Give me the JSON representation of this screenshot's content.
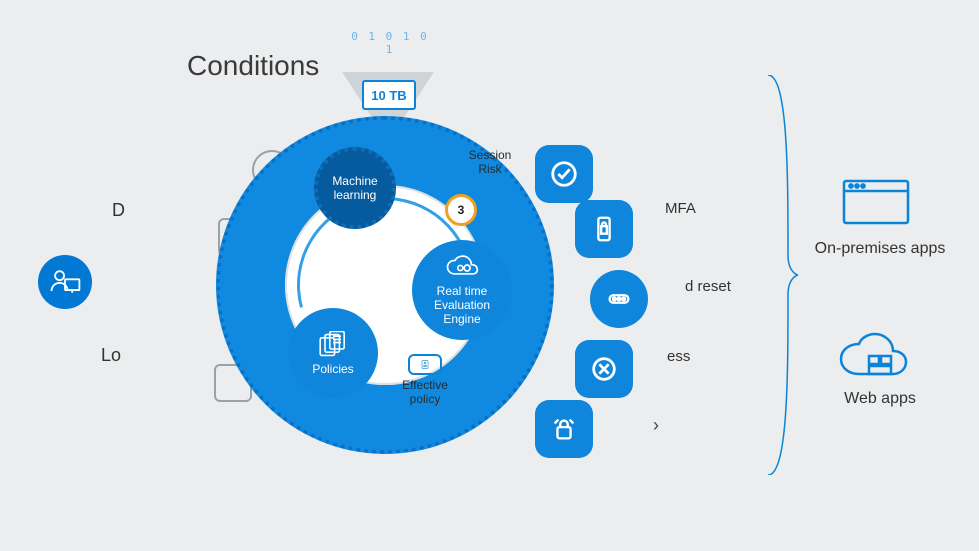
{
  "title": "Conditions",
  "left": {
    "frag_d": "D",
    "frag_lo": "Lo"
  },
  "feed": {
    "bits": "0 1 0 1 0 1",
    "folder_label": "10 TB"
  },
  "engine": {
    "ml": "Machine learning",
    "session_label": "Session Risk",
    "risk_score": "3",
    "rte": "Real time Evaluation Engine",
    "policies": "Policies",
    "eff_policy": "Effective policy"
  },
  "actions": {
    "mfa": "MFA",
    "reset": "d reset",
    "ess": "ess",
    "arrow": "›"
  },
  "apps": {
    "onprem": "On-premises apps",
    "web": "Web apps"
  }
}
